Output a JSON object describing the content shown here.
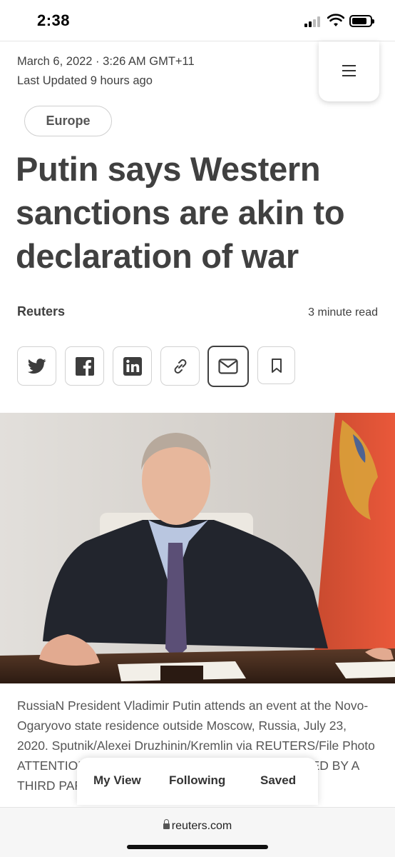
{
  "status_bar": {
    "time": "2:38"
  },
  "article": {
    "date": "March 6, 2022 · 3:26 AM GMT+11",
    "last_updated": "Last Updated 9 hours ago",
    "category": "Europe",
    "headline": "Putin says Western sanctions are akin to declaration of war",
    "author": "Reuters",
    "read_time": "3 minute read",
    "caption": "RussiaN President Vladimir Putin attends an event at the Novo-Ogaryovo state residence outside Moscow, Russia, July 23, 2020. Sputnik/Alexei Druzhinin/Kremlin via REUTERS/File Photo ATTENTION EDITORS - THIS IMAGE WAS PROVIDED BY A THIRD PARTY. Acquire Licensing Rights Photo"
  },
  "share_buttons": [
    {
      "icon": "twitter-icon"
    },
    {
      "icon": "facebook-icon"
    },
    {
      "icon": "linkedin-icon"
    },
    {
      "icon": "link-icon"
    },
    {
      "icon": "email-icon"
    },
    {
      "icon": "bookmark-icon"
    }
  ],
  "floating_nav": {
    "my_view": "My View",
    "following": "Following",
    "saved": "Saved"
  },
  "browser": {
    "url": "reuters.com"
  }
}
